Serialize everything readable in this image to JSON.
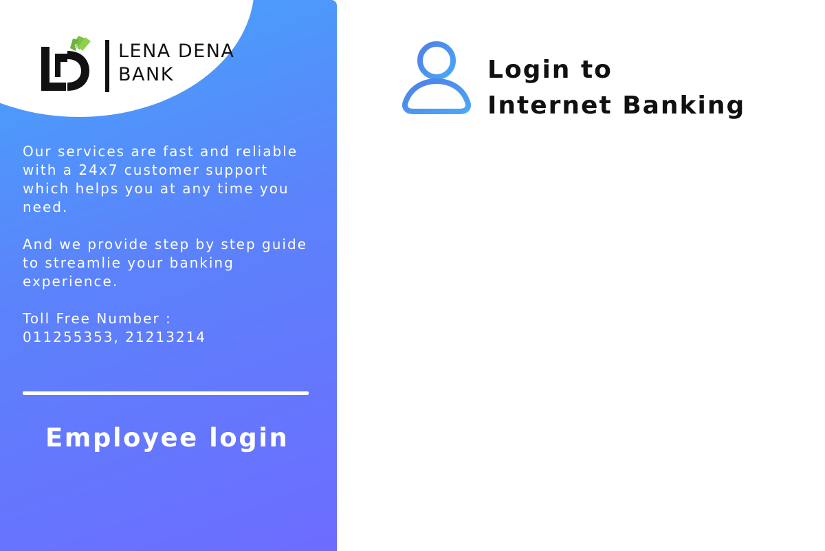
{
  "colors": {
    "panel_gradient_start": "#45a6fb",
    "panel_gradient_end": "#6d6cff",
    "accent_green": "#7cc242",
    "text_dark": "#111111",
    "icon_blue": "#5b8ef0"
  },
  "brand": {
    "logo_icon": "lena-dena-monogram-icon",
    "name_line1": "LENA DENA",
    "name_line2": "BANK"
  },
  "info": {
    "paragraph1": "Our services are fast and reliable with a 24x7 customer support which helps you at any time you need.",
    "paragraph2": "And we provide step by step guide to streamlie your banking experience.",
    "toll_free_label": "Toll Free Number :",
    "toll_free_numbers": "011255353, 21213214"
  },
  "employee_login": {
    "label": "Employee login"
  },
  "login": {
    "icon": "user-icon",
    "title_line1": "Login to",
    "title_line2": "Internet Banking"
  }
}
